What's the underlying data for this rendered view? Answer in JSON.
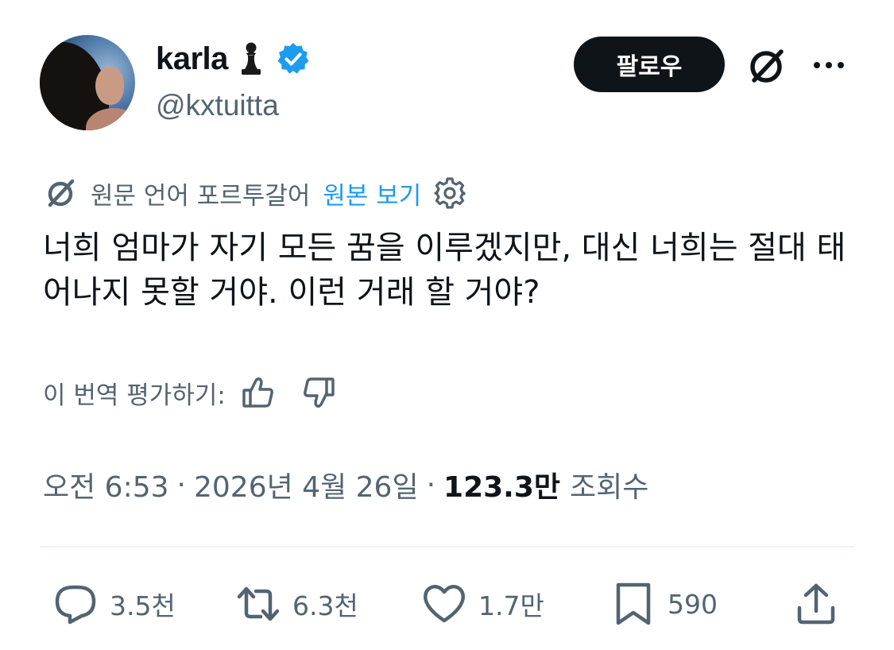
{
  "user": {
    "display_name": "karla",
    "name_emoji": "chess-pawn",
    "handle": "@kxtuitta",
    "verified": true
  },
  "header": {
    "follow_label": "팔로우",
    "grok_icon": "grok-icon",
    "more_icon": "more-icon"
  },
  "translation": {
    "notice": "원문 언어 포르투갈어",
    "show_original_label": "원본 보기",
    "rate_label": "이 번역 평가하기:"
  },
  "tweet": {
    "text": "너희 엄마가 자기 모든 꿈을 이루겠지만, 대신 너희는 절대 태어나지 못할 거야. 이런 거래 할 거야?"
  },
  "meta": {
    "time": "오전 6:53",
    "dot": "·",
    "date": "2026년 4월 26일",
    "views_count": "123.3만",
    "views_label": "조회수"
  },
  "actions": {
    "replies": "3.5천",
    "retweets": "6.3천",
    "likes": "1.7만",
    "bookmarks": "590"
  },
  "colors": {
    "text_primary": "#0f1419",
    "text_secondary": "#536471",
    "accent": "#1d9bf0",
    "divider": "#eff3f4"
  }
}
